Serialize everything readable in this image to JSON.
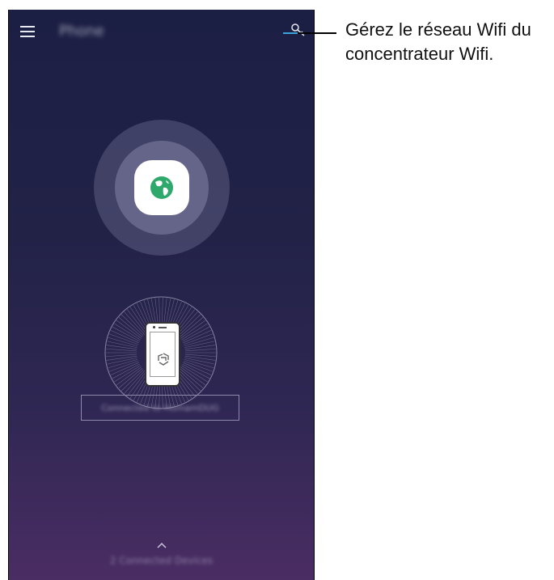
{
  "app": {
    "title": "Phone",
    "status_text": "Connected to HomamDUG",
    "connected_devices": "2 Connected Devices"
  },
  "icons": {
    "menu": "menu-icon",
    "settings": "key-icon",
    "hub": "globe-icon",
    "device": "smartphone-icon",
    "expand": "chevron-up-icon"
  },
  "callout": {
    "line1": "Gérez le réseau Wifi du",
    "line2": "concentrateur Wifi."
  },
  "colors": {
    "background_top": "#1c1f44",
    "background_bottom": "#4a2d63",
    "globe_green": "#2fa86b",
    "callout_line": "#3aa3d9"
  }
}
